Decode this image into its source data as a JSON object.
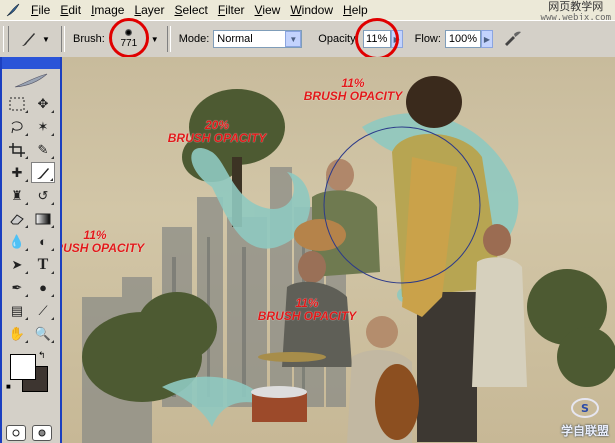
{
  "menubar": {
    "items": [
      "File",
      "Edit",
      "Image",
      "Layer",
      "Select",
      "Filter",
      "View",
      "Window",
      "Help"
    ],
    "watermark_line1": "网页教学网",
    "watermark_line2": "www.webjx.com"
  },
  "options": {
    "brush_label": "Brush:",
    "brush_size": "771",
    "mode_label": "Mode:",
    "mode_value": "Normal",
    "opacity_label": "Opacity:",
    "opacity_value": "11%",
    "flow_label": "Flow:",
    "flow_value": "100%"
  },
  "annotations": {
    "a1_pct": "11%",
    "a1_text": "BRUSH OPACITY",
    "a2_pct": "20%",
    "a2_text": "BRUSH OPACITY",
    "a3_pct": "11%",
    "a3_text": "BRUSH OPACITY",
    "a4_pct": "11%",
    "a4_text": "BRUSH OPACITY"
  },
  "bottom_watermark": "学自联盟",
  "colors": {
    "accent_ring": "#e00000",
    "annotation": "#e11a1a",
    "fg": "#ffffff",
    "bg": "#3d3530",
    "swirl": "#8fc9c0"
  }
}
